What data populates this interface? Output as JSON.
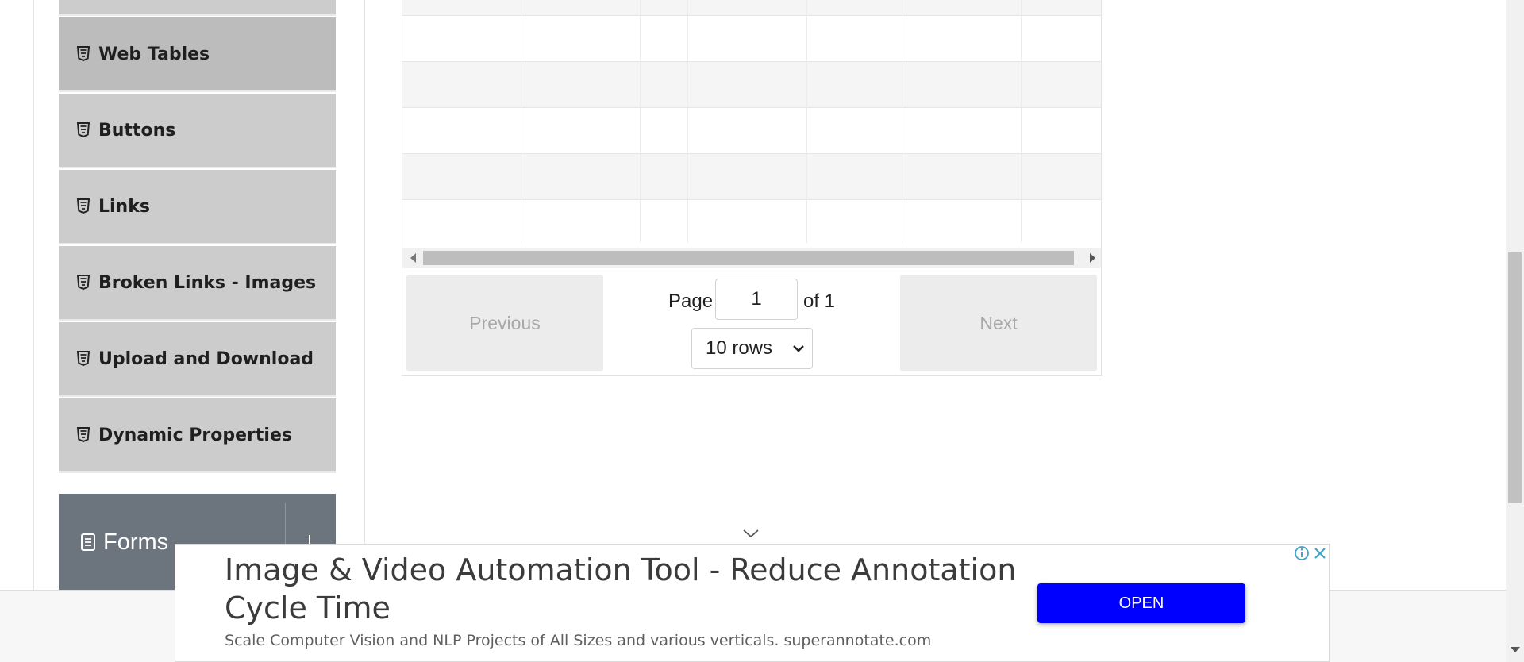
{
  "sidebar": {
    "items": [
      {
        "label": "Web Tables",
        "icon": "html5-icon",
        "active": true
      },
      {
        "label": "Buttons",
        "icon": "html5-icon",
        "active": false
      },
      {
        "label": "Links",
        "icon": "html5-icon",
        "active": false
      },
      {
        "label": "Broken Links - Images",
        "icon": "html5-icon",
        "active": false
      },
      {
        "label": "Upload and Download",
        "icon": "html5-icon",
        "active": false
      },
      {
        "label": "Dynamic Properties",
        "icon": "html5-icon",
        "active": false
      }
    ],
    "forms_group": {
      "label": "Forms",
      "icon": "document-icon",
      "toggle_icon": "arrow-icon"
    }
  },
  "pagination": {
    "previous_label": "Previous",
    "next_label": "Next",
    "page_label": "Page",
    "current_page": "1",
    "of_label": "of 1",
    "rows_selected": "10 rows"
  },
  "ad": {
    "headline": "Image & Video Automation Tool - Reduce Annotation Cycle Time",
    "description": "Scale Computer Vision and NLP Projects of All Sizes and various verticals. superannotate.com",
    "cta_label": "OPEN",
    "cta_color": "#0000ff",
    "icons": [
      "adchoices-icon",
      "close-icon"
    ]
  },
  "colors": {
    "sidebar_item_bg": "#cccccc",
    "sidebar_active_bg": "#bcbcbc",
    "forms_header_bg": "#6c757d"
  }
}
